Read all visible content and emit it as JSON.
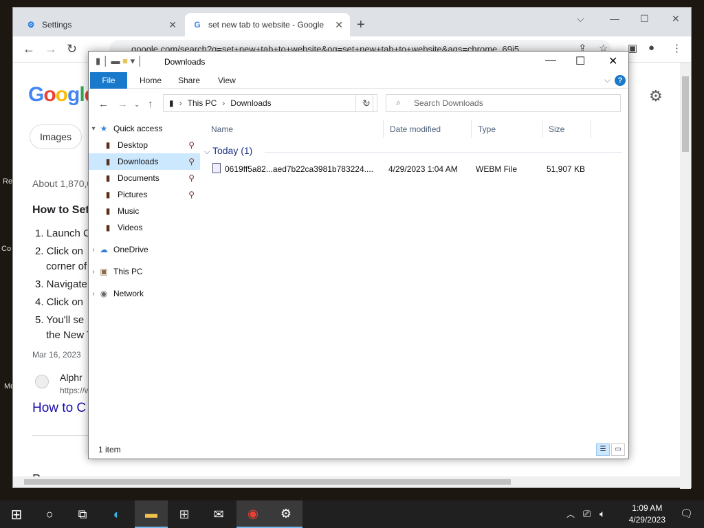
{
  "desktop": {
    "edge_labels": [
      "Re",
      "Co",
      "Mo"
    ]
  },
  "chrome": {
    "tabs": [
      {
        "title": "Settings",
        "icon": "gear-icon"
      },
      {
        "title": "set new tab to website - Google",
        "icon": "google-g-icon"
      }
    ],
    "url": "google.com/search?q=set+new+tab+to+website&oq=set+new+tab+to+website&aqs=chrome..69i5",
    "page": {
      "logo": "Google",
      "images_chip": "Images",
      "about_results": "About 1,870,0",
      "snippet_title": "How to Set",
      "steps": [
        "1. Launch C",
        "2. Click on",
        "corner of",
        "3. Navigate",
        "4. Click on",
        "5. You'll se",
        "the New Tab page"
      ],
      "date": "Mar 16, 2023",
      "source_name": "Alphr",
      "source_url": "https://w",
      "result_link": "How to C",
      "people_also": "Pe"
    }
  },
  "explorer": {
    "title": "Downloads",
    "ribbon": {
      "file": "File",
      "home": "Home",
      "share": "Share",
      "view": "View"
    },
    "address": {
      "root": "This PC",
      "folder": "Downloads"
    },
    "search_placeholder": "Search Downloads",
    "columns": {
      "name": "Name",
      "date": "Date modified",
      "type": "Type",
      "size": "Size"
    },
    "group": "Today (1)",
    "files": [
      {
        "name": "0619ff5a82...aed7b22ca3981b783224....",
        "date": "4/29/2023 1:04 AM",
        "type": "WEBM File",
        "size": "51,907 KB"
      }
    ],
    "nav": {
      "quick_access": "Quick access",
      "desktop": "Desktop",
      "downloads": "Downloads",
      "documents": "Documents",
      "pictures": "Pictures",
      "music": "Music",
      "videos": "Videos",
      "onedrive": "OneDrive",
      "this_pc": "This PC",
      "network": "Network"
    },
    "status": "1 item"
  },
  "taskbar": {
    "time": "1:09 AM",
    "date": "4/29/2023"
  }
}
